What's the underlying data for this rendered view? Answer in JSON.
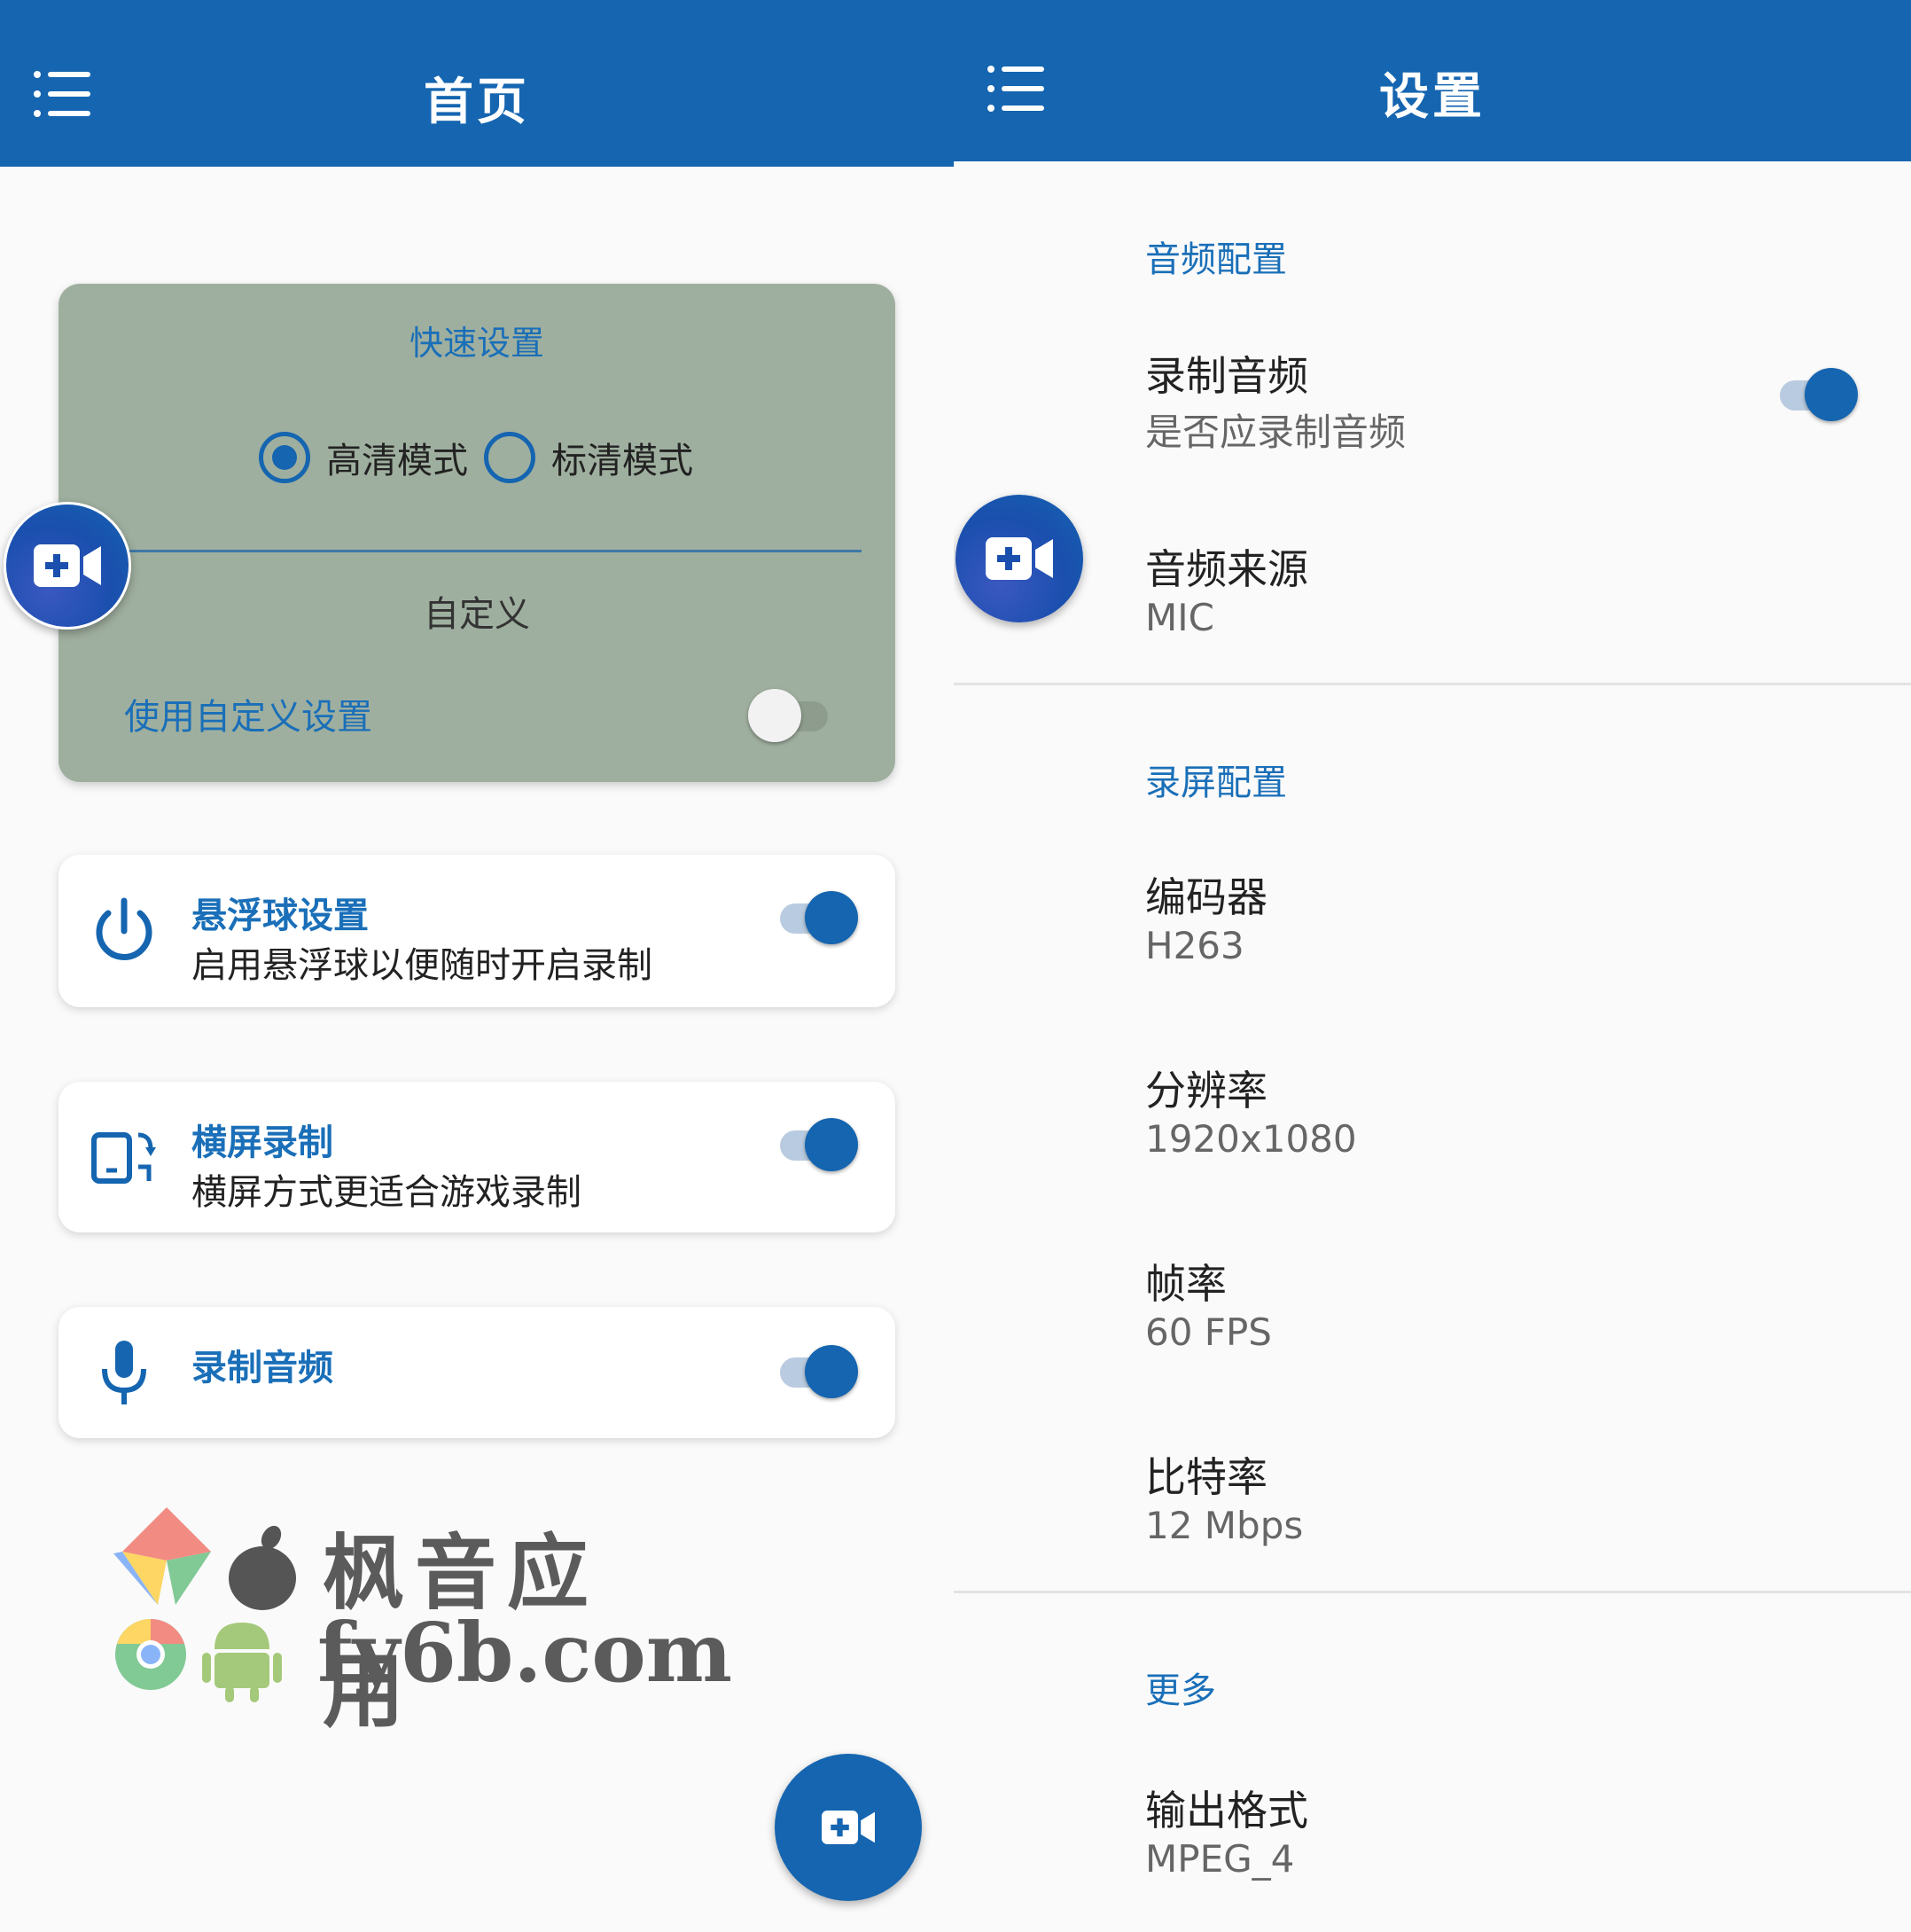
{
  "colors": {
    "primary": "#1565b0",
    "accent_text": "#1a6fb8",
    "card_background": "#9faf9f",
    "background": "#fafafa"
  },
  "home": {
    "appbar_title": "首页",
    "menu_icon": "menu-list-icon",
    "quick_settings": {
      "title": "快速设置",
      "radio_options": [
        {
          "label": "高清模式",
          "selected": true
        },
        {
          "label": "标清模式",
          "selected": false
        }
      ],
      "custom_label": "自定义",
      "custom_toggle_label": "使用自定义设置",
      "custom_toggle_on": false
    },
    "options": [
      {
        "icon": "power-icon",
        "title": "悬浮球设置",
        "subtitle": "启用悬浮球以便随时开启录制",
        "on": true
      },
      {
        "icon": "screen-rotation-icon",
        "title": "横屏录制",
        "subtitle": "横屏方式更适合游戏录制",
        "on": true
      },
      {
        "icon": "microphone-icon",
        "title": "录制音频",
        "subtitle": "",
        "on": true
      }
    ],
    "fab_icon": "video-add-icon",
    "watermark": {
      "line1": "枫音应用",
      "line2": "fy6b.com"
    }
  },
  "settings": {
    "appbar_title": "设置",
    "menu_icon": "menu-list-icon",
    "sections": [
      {
        "header": "音频配置",
        "items": [
          {
            "title": "录制音频",
            "value": "是否应录制音频",
            "toggle_on": true
          },
          {
            "title": "音频来源",
            "value": "MIC"
          }
        ]
      },
      {
        "header": "录屏配置",
        "items": [
          {
            "title": "编码器",
            "value": "H263"
          },
          {
            "title": "分辨率",
            "value": "1920x1080"
          },
          {
            "title": "帧率",
            "value": "60 FPS"
          },
          {
            "title": "比特率",
            "value": "12 Mbps"
          }
        ]
      },
      {
        "header": "更多",
        "items": [
          {
            "title": "输出格式",
            "value": "MPEG_4"
          }
        ]
      }
    ]
  }
}
